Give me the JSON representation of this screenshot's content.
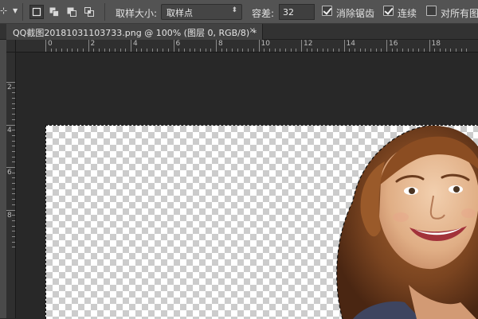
{
  "options_bar": {
    "tool_icon": "magic-wand-tool-icon",
    "sample_size_label": "取样大小:",
    "sample_size_value": "取样点",
    "tolerance_label": "容差:",
    "tolerance_value": "32",
    "antialias_label": "消除锯齿",
    "antialias_checked": true,
    "contiguous_label": "连续",
    "contiguous_checked": true,
    "sample_all_layers_label": "对所有图层",
    "sample_all_layers_checked": false,
    "selection_modes": [
      "new-selection-icon",
      "add-to-selection-icon",
      "subtract-from-selection-icon",
      "intersect-selection-icon"
    ]
  },
  "document_tab": {
    "title": "QQ截图20181031103733.png @ 100% (图层 0, RGB/8) *",
    "close_glyph": "×"
  },
  "rulers": {
    "horizontal_labels": [
      "0",
      "2",
      "4",
      "6",
      "8",
      "10",
      "12",
      "14",
      "16",
      "18"
    ],
    "vertical_labels": [
      "2",
      "4",
      "6",
      "8"
    ]
  },
  "colors": {
    "options_bar_bg": "#535353",
    "workspace_bg": "#282828",
    "checker_light": "#ffffff",
    "checker_dark": "#cccccc"
  }
}
